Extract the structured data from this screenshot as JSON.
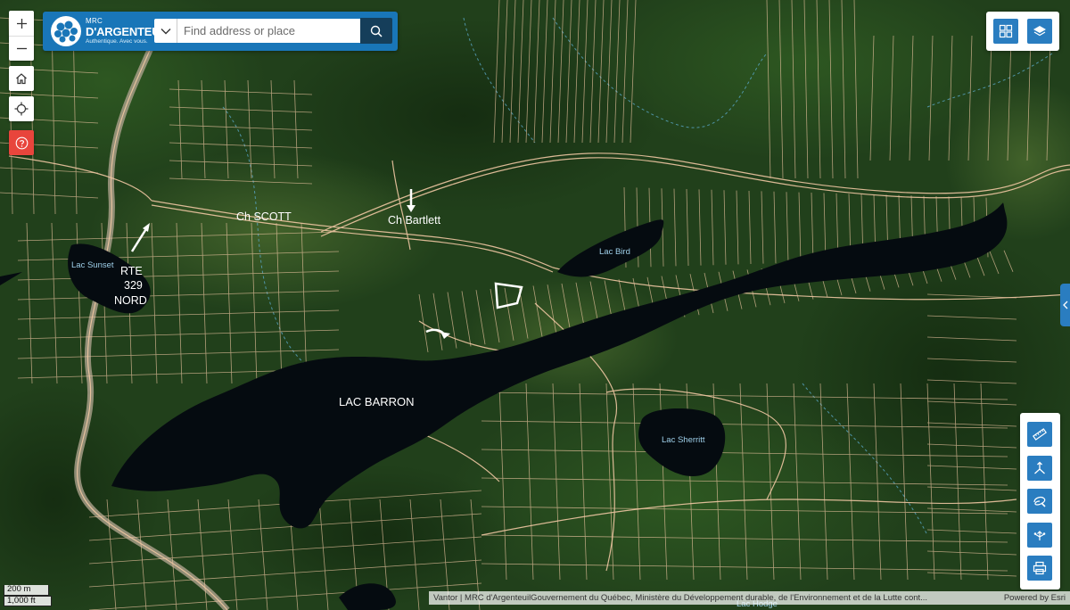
{
  "header": {
    "logo_line1": "MRC",
    "logo_line2": "D'ARGENTEUIL",
    "logo_tagline": "Authentique. Avec vous.",
    "search_placeholder": "Find address or place"
  },
  "map_labels": {
    "road_scott": "Ch SCOTT",
    "road_bartlett": "Ch Bartlett",
    "route_line1": "RTE",
    "route_line2": "329",
    "route_line3": "NORD",
    "lake_barron": "LAC BARRON",
    "lake_bird": "Lac Bird",
    "lake_sunset": "Lac Sunset",
    "lake_sherritt": "Lac Sherritt",
    "lake_hodge": "Lac Hodge"
  },
  "scalebar": {
    "metric": "200 m",
    "imperial": "1,000 ft"
  },
  "attribution": {
    "text": "Vantor | MRC d'ArgenteuilGouvernement du Québec, Ministère du Développement durable, de l'Environnement et de la Lutte cont...",
    "powered_by": "Powered by Esri"
  },
  "icons": {
    "zoom_in": "plus-icon",
    "zoom_out": "minus-icon",
    "home": "home-icon",
    "locate": "crosshair-icon",
    "help": "help-icon",
    "search_dropdown": "chevron-down-icon",
    "search": "search-icon",
    "basemap_gallery": "grid-icon",
    "layers": "layers-icon",
    "side_panel": "chevron-left-icon",
    "measure": "ruler-icon",
    "directions": "route-icon",
    "sketch": "draw-icon",
    "share": "share-icon",
    "print": "print-icon"
  },
  "colors": {
    "brand_blue": "#1976b8",
    "button_blue": "#2a7dc0",
    "search_button": "#153e5a",
    "help_red": "#e8453c",
    "parcel_lines": "#f0c7a3",
    "water": "#050b10"
  }
}
